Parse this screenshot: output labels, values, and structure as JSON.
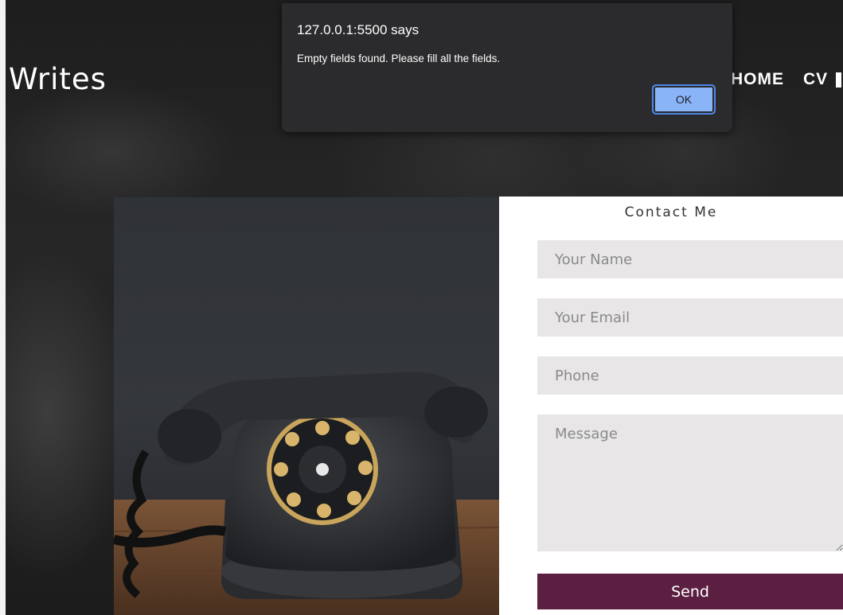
{
  "header": {
    "brand": "Writes",
    "nav": [
      "HOME",
      "CV"
    ]
  },
  "contact": {
    "title": "Contact Me",
    "name_placeholder": "Your Name",
    "email_placeholder": "Your Email",
    "phone_placeholder": "Phone",
    "message_placeholder": "Message",
    "send_label": "Send",
    "send_color": "#5b1f42"
  },
  "alert": {
    "origin": "127.0.0.1:5500 says",
    "message": "Empty fields found. Please fill all the fields.",
    "ok_label": "OK"
  },
  "icons": {
    "photo": "vintage-rotary-telephone"
  }
}
